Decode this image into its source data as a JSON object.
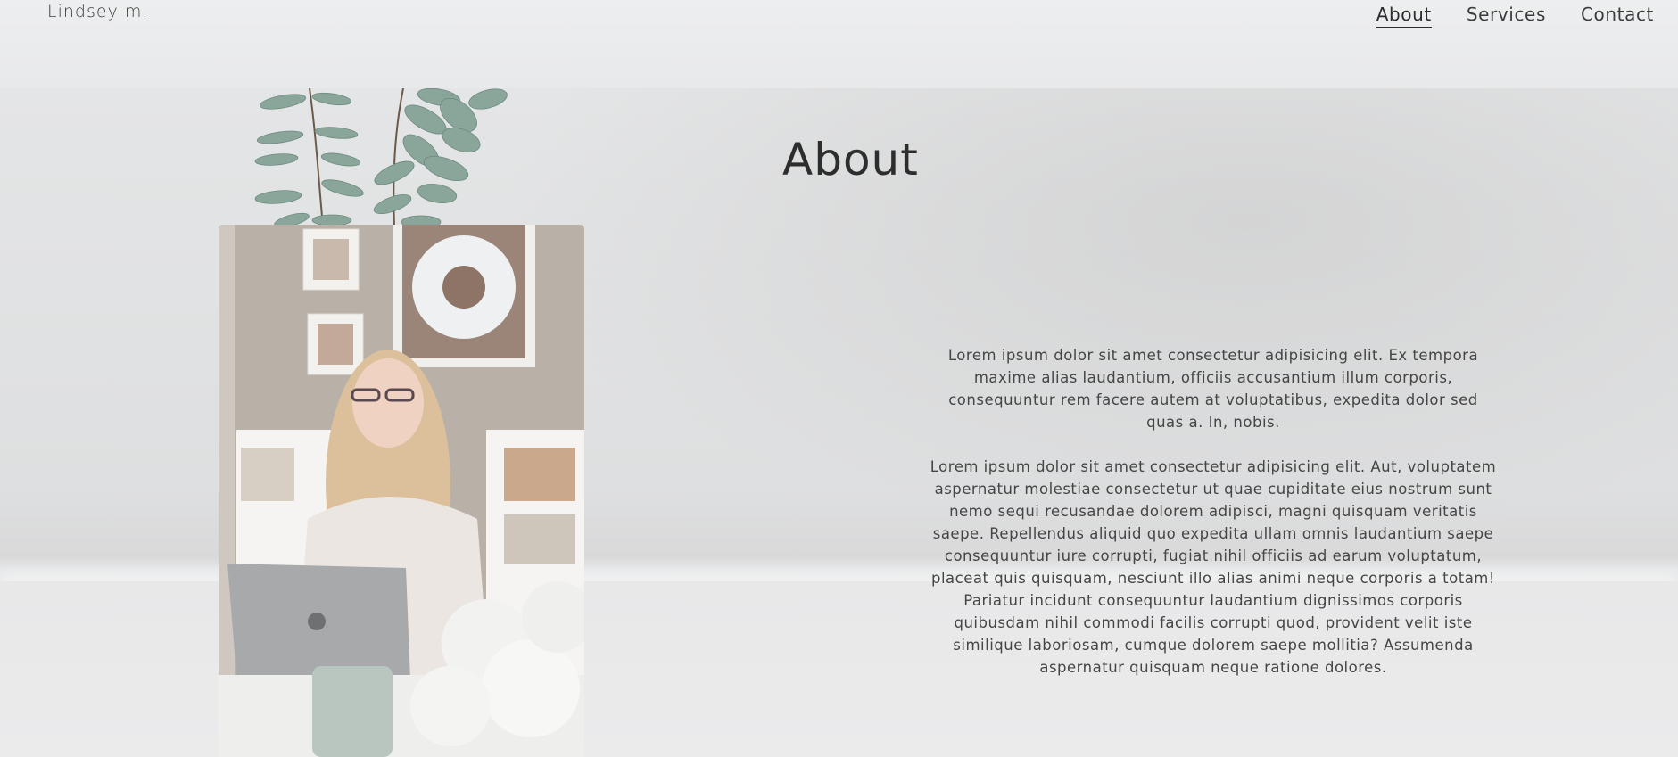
{
  "header": {
    "brand": "Lindsey m.",
    "nav": [
      {
        "label": "About",
        "active": true
      },
      {
        "label": "Services",
        "active": false
      },
      {
        "label": "Contact",
        "active": false
      }
    ]
  },
  "main": {
    "heading": "About",
    "paragraphs": [
      "Lorem ipsum dolor sit amet consectetur adipisicing elit. Ex tempora maxime alias laudantium, officiis accusantium illum corporis, consequuntur rem facere autem at voluptatibus, expedita dolor sed quas a. In, nobis.",
      "Lorem ipsum dolor sit amet consectetur adipisicing elit. Aut, voluptatem aspernatur molestiae consectetur ut quae cupiditate eius nostrum sunt nemo sequi recusandae dolorem adipisci, magni quisquam veritatis saepe. Repellendus aliquid quo expedita ullam omnis laudantium saepe consequuntur iure corrupti, fugiat nihil officiis ad earum voluptatum, placeat quis quisquam, nesciunt illo alias animi neque corporis a totam! Pariatur incidunt consequuntur laudantium dignissimos corporis quibusdam nihil commodi facilis corrupti quod, provident velit iste similique laboriosam, cumque dolorem saepe mollitia? Assumenda aspernatur quisquam neque ratione dolores."
    ]
  },
  "colors": {
    "background": "#e9eaeb",
    "text": "#333333",
    "accent_plant": "#7f9a8c"
  },
  "icons": {
    "plant": "eucalyptus-plant-decoration",
    "photo": "portrait-photo"
  }
}
